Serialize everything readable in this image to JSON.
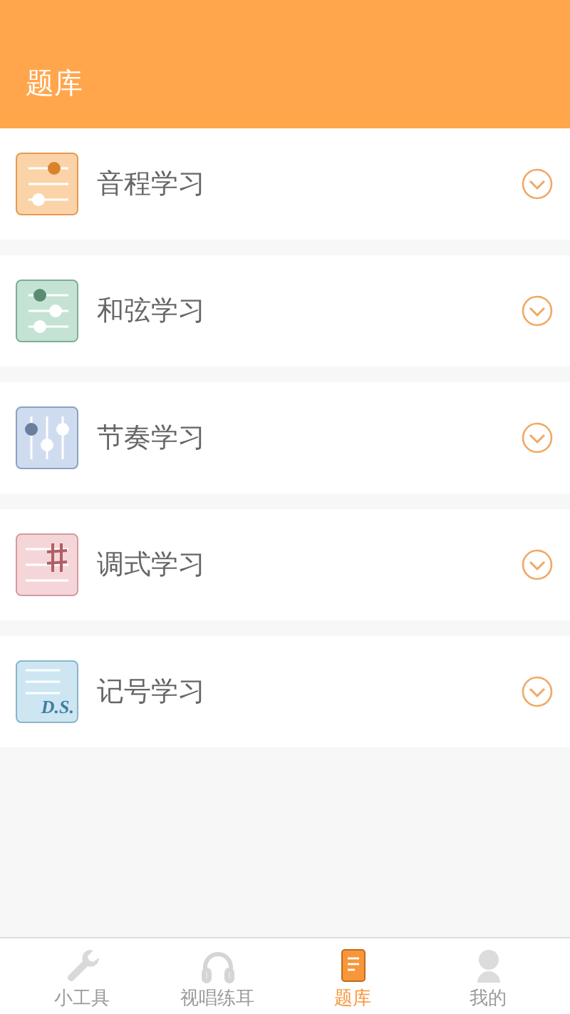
{
  "header": {
    "title": "题库"
  },
  "sections": [
    {
      "label": "音程学习",
      "kind": "interval",
      "expanded": false
    },
    {
      "label": "和弦学习",
      "kind": "chord",
      "expanded": false
    },
    {
      "label": "节奏学习",
      "kind": "rhythm",
      "expanded": false
    },
    {
      "label": "调式学习",
      "kind": "mode",
      "expanded": false
    },
    {
      "label": "记号学习",
      "kind": "notation",
      "expanded": false,
      "icon_text": "D.S."
    }
  ],
  "tabs": [
    {
      "label": "小工具",
      "kind": "tools",
      "selected": false
    },
    {
      "label": "视唱练耳",
      "kind": "ear",
      "selected": false
    },
    {
      "label": "题库",
      "kind": "bank",
      "selected": true
    },
    {
      "label": "我的",
      "kind": "me",
      "selected": false
    }
  ]
}
